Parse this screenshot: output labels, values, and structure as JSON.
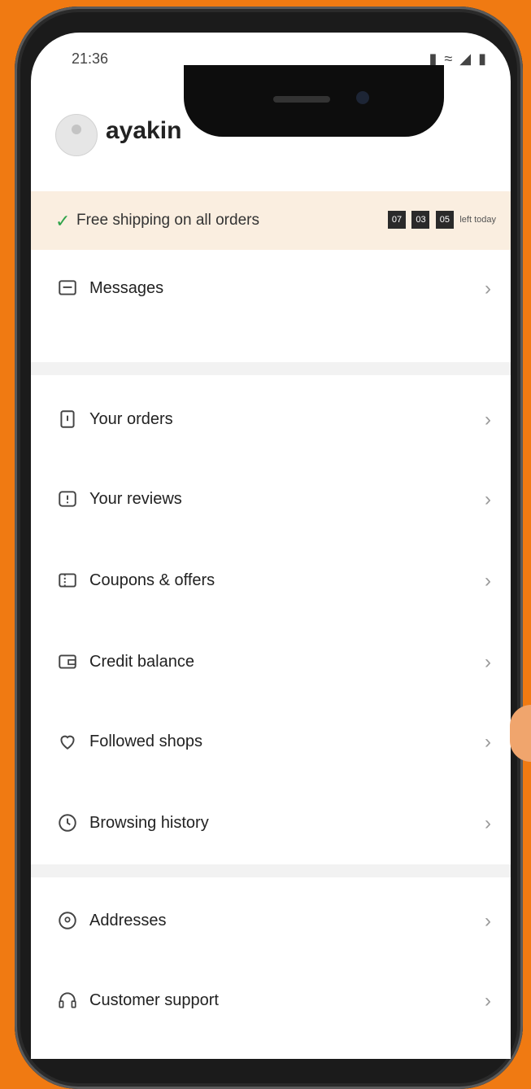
{
  "status_bar": {
    "time": "21:36",
    "icons": "▮ ≈ ◢ ▮"
  },
  "profile": {
    "username": "ayakin"
  },
  "banner": {
    "text": "Free shipping on all orders",
    "timer": [
      "07",
      "03",
      "05"
    ],
    "timer_suffix": "left today"
  },
  "menu": {
    "messages": "Messages",
    "orders": "Your orders",
    "reviews": "Your reviews",
    "coupons": "Coupons & offers",
    "credit": "Credit balance",
    "followed": "Followed shops",
    "history": "Browsing history",
    "addresses": "Addresses",
    "support": "Customer support"
  },
  "colors": {
    "background": "#f07a12",
    "banner": "#faeee0",
    "check": "#2fa34a"
  }
}
